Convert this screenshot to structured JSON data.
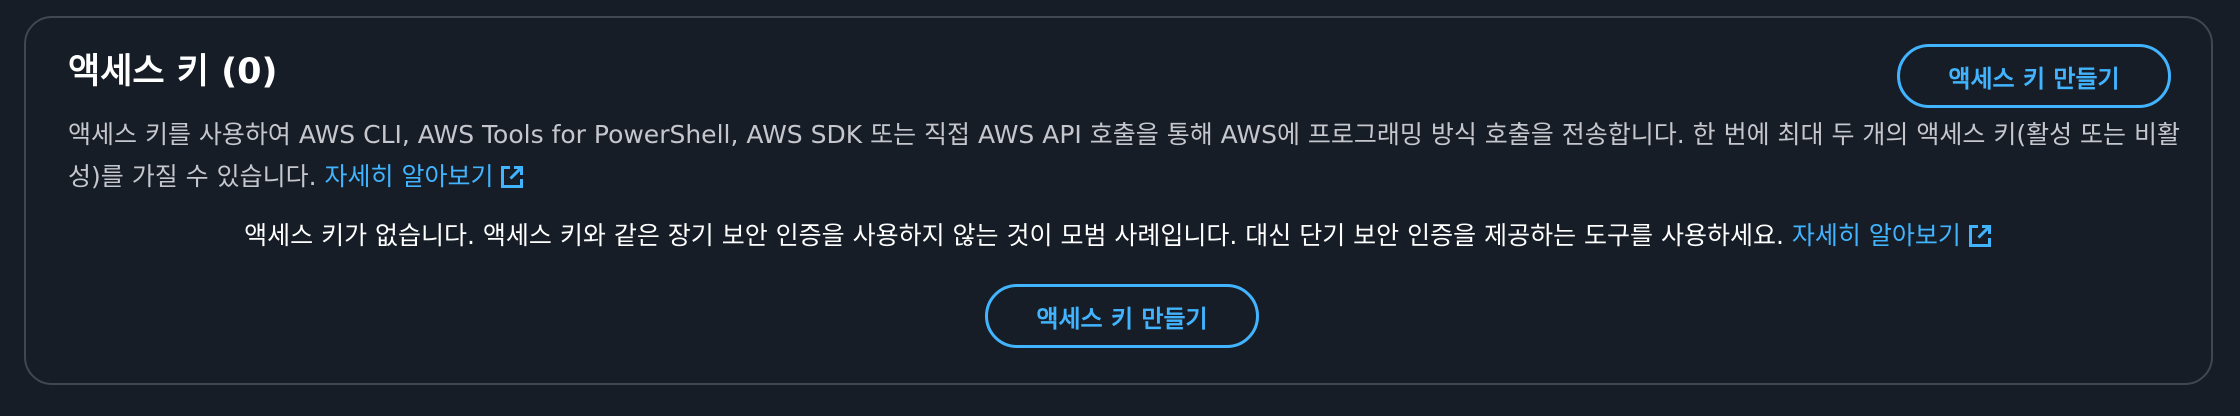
{
  "section": {
    "title": "액세스 키 (0)",
    "create_button_label": "액세스 키 만들기",
    "description": "액세스 키를 사용하여 AWS CLI, AWS Tools for PowerShell, AWS SDK 또는 직접 AWS API 호출을 통해 AWS에 프로그래밍 방식 호출을 전송합니다. 한 번에 최대 두 개의 액세스 키(활성 또는 비활성)를 가질 수 있습니다.",
    "learn_more_label": "자세히 알아보기"
  },
  "empty_state": {
    "message": "액세스 키가 없습니다. 액세스 키와 같은 장기 보안 인증을 사용하지 않는 것이 모범 사례입니다. 대신 단기 보안 인증을 제공하는 도구를 사용하세요.",
    "learn_more_label": "자세히 알아보기",
    "create_button_label": "액세스 키 만들기"
  },
  "icons": {
    "external_link": "external-link-icon"
  },
  "colors": {
    "background": "#161d26",
    "border": "#424650",
    "accent": "#42b4ff",
    "text_primary": "#ffffff",
    "text_secondary": "#c6c6cd"
  }
}
